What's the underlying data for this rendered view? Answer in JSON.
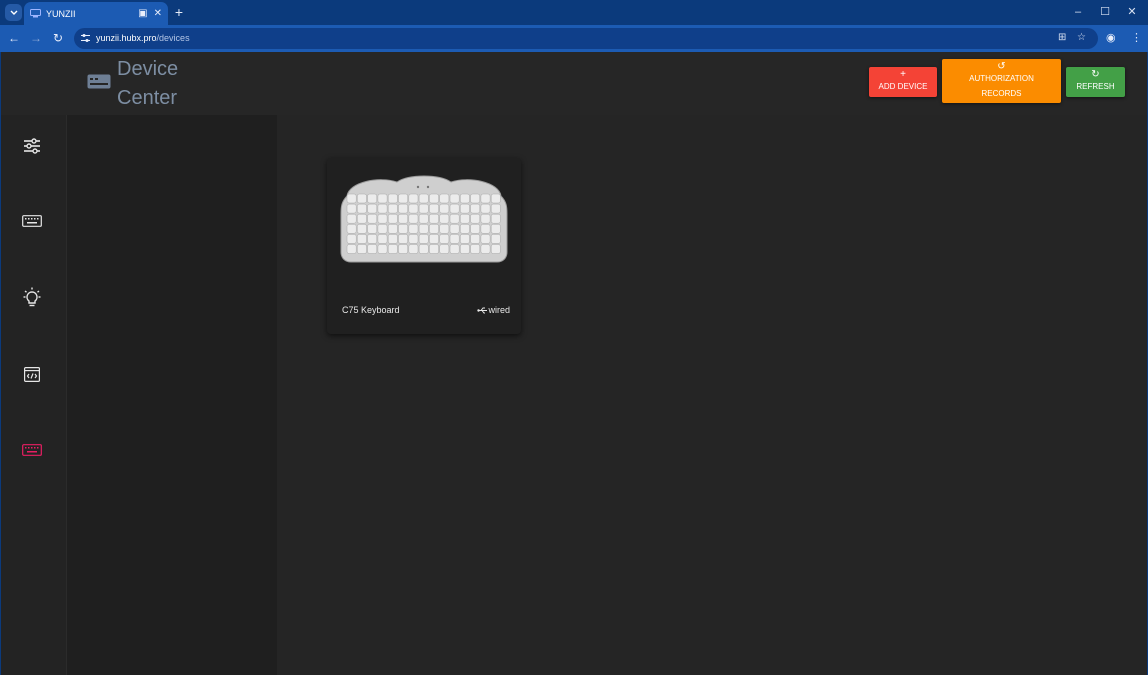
{
  "browser": {
    "tab_title": "YUNZII",
    "url_host": "yunzii.hubx.pro",
    "url_path": "/devices"
  },
  "header": {
    "title": "Device Center",
    "buttons": {
      "add_device": "ADD DEVICE",
      "authorization_records": "AUTHORIZATION RECORDS",
      "refresh": "REFRESH"
    }
  },
  "sidebar": {
    "items": [
      {
        "icon": "sliders-icon",
        "active": false
      },
      {
        "icon": "keyboard-icon",
        "active": false
      },
      {
        "icon": "lightbulb-icon",
        "active": false
      },
      {
        "icon": "code-window-icon",
        "active": false
      },
      {
        "icon": "keyboard-icon",
        "active": true
      }
    ]
  },
  "devices": [
    {
      "name": "C75 Keyboard",
      "connection": "wired"
    }
  ],
  "colors": {
    "add": "#f44336",
    "auth": "#fb8c00",
    "refresh": "#43a047",
    "active_sidebar": "#e91e63",
    "title": "#7d8ea3"
  }
}
